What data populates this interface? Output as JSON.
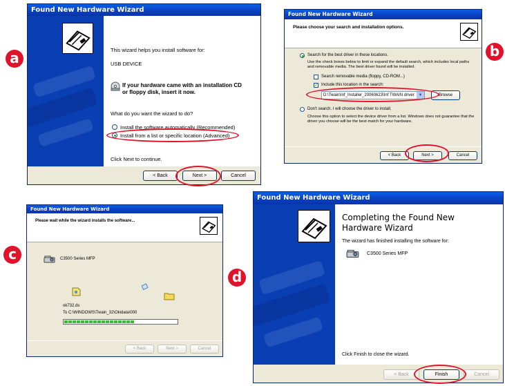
{
  "badges": {
    "a": "a",
    "b": "b",
    "c": "c",
    "d": "d"
  },
  "colors": {
    "title_bar": "#0a3fb4",
    "highlight": "#e0132b",
    "window_face": "#ece9d8",
    "progress": "#2ac52a"
  },
  "wizard_a": {
    "title": "Found New Hardware Wizard",
    "intro": "This wizard helps you install software for:",
    "device": "USB DEVICE",
    "cd_hint_line1": "If your hardware came with an installation CD",
    "cd_hint_line2": "or floppy disk, insert it now.",
    "question": "What do you want the wizard to do?",
    "option_auto": "Install the software automatically (Recommended)",
    "option_list": "Install from a list or specific location (Advanced)",
    "continue_hint": "Click Next to continue.",
    "back_label": "< Back",
    "next_label": "Next >",
    "cancel_label": "Cancel"
  },
  "wizard_b": {
    "title": "Found New Hardware Wizard",
    "header": "Please choose your search and installation options.",
    "option_search": "Search for the best driver in these locations.",
    "search_desc": "Use the check boxes below to limit or expand the default search, which includes local paths and removable media. The best driver found will be installed.",
    "check_removable": "Search removable media (floppy, CD-ROM...)",
    "check_include": "Include this location in the search:",
    "location_path": "D:\\Twain\\Inf_Installer_20060623\\Inf TWAIN driver",
    "browse_label": "Browse",
    "option_dont_search": "Don't search. I will choose the driver to install.",
    "dont_search_desc": "Choose this option to select the device driver from a list. Windows does not guarantee that the driver you choose will be the best match for your hardware.",
    "back_label": "< Back",
    "next_label": "Next >",
    "cancel_label": "Cancel"
  },
  "wizard_c": {
    "title": "Found New Hardware Wizard",
    "header": "Please wait while the wizard installs the software...",
    "device": "C3500 Series MFP",
    "file_name": "ok732.ds",
    "destination": "To C:\\WINDOWS\\Twain_32\\Okidata\\000",
    "progress_fraction": 0.62,
    "back_label": "< Back",
    "next_label": "Next >",
    "cancel_label": "Cancel"
  },
  "wizard_d": {
    "title": "Found New Hardware Wizard",
    "heading_line1": "Completing the Found New",
    "heading_line2": "Hardware Wizard",
    "finished_text": "The wizard has finished installing the software for:",
    "device": "C3500 Series MFP",
    "finish_hint": "Click Finish to close the wizard.",
    "back_label": "< Back",
    "finish_label": "Finish",
    "cancel_label": "Cancel"
  }
}
